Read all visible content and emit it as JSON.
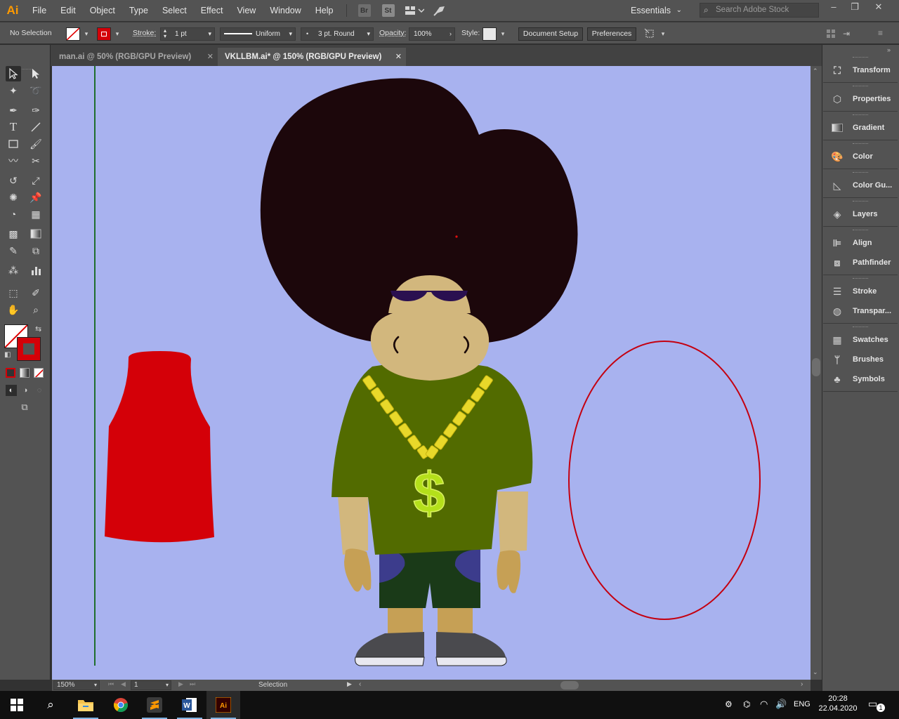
{
  "app": {
    "logo": "Ai",
    "brand_color": "#ff9a00"
  },
  "menu": [
    "File",
    "Edit",
    "Object",
    "Type",
    "Select",
    "Effect",
    "View",
    "Window",
    "Help"
  ],
  "menu_icons": {
    "bridge": "Br",
    "stock": "St"
  },
  "workspace": "Essentials",
  "search_placeholder": "Search Adobe Stock",
  "control": {
    "selection": "No Selection",
    "stroke_label": "Stroke:",
    "stroke_weight": "1 pt",
    "stroke_profile": "Uniform",
    "brush": "3 pt. Round",
    "opacity_label": "Opacity:",
    "opacity": "100%",
    "style_label": "Style:",
    "document_setup": "Document Setup",
    "preferences": "Preferences"
  },
  "tabs": [
    {
      "label": "man.ai @ 50% (RGB/GPU Preview)",
      "active": false
    },
    {
      "label": "VKLLBM.ai* @ 150% (RGB/GPU Preview)",
      "active": true
    }
  ],
  "status": {
    "zoom": "150%",
    "artboard": "1",
    "tool": "Selection"
  },
  "panels": [
    "Transform",
    "Properties",
    "Gradient",
    "Color",
    "Color Gu...",
    "Layers",
    "Align",
    "Pathfinder",
    "Stroke",
    "Transpar...",
    "Swatches",
    "Brushes",
    "Symbols"
  ],
  "canvas": {
    "background": "#a8b2ef",
    "hair_color": "#1c070b",
    "skin_color": "#d2b77d",
    "shirt_color": "#526b00",
    "chain_color": "#e8d82a",
    "dollar_color": "#b4e01a",
    "shorts_color": "#1a3a18",
    "pocket_color": "#3c3c8c",
    "shoe_color": "#4a4a4e",
    "tank_color": "#d40008",
    "ellipse_stroke": "#c40010",
    "guide_color": "#1f6e2c"
  },
  "taskbar": {
    "lang": "ENG",
    "time": "20:28",
    "date": "22.04.2020",
    "notification_count": "1"
  }
}
